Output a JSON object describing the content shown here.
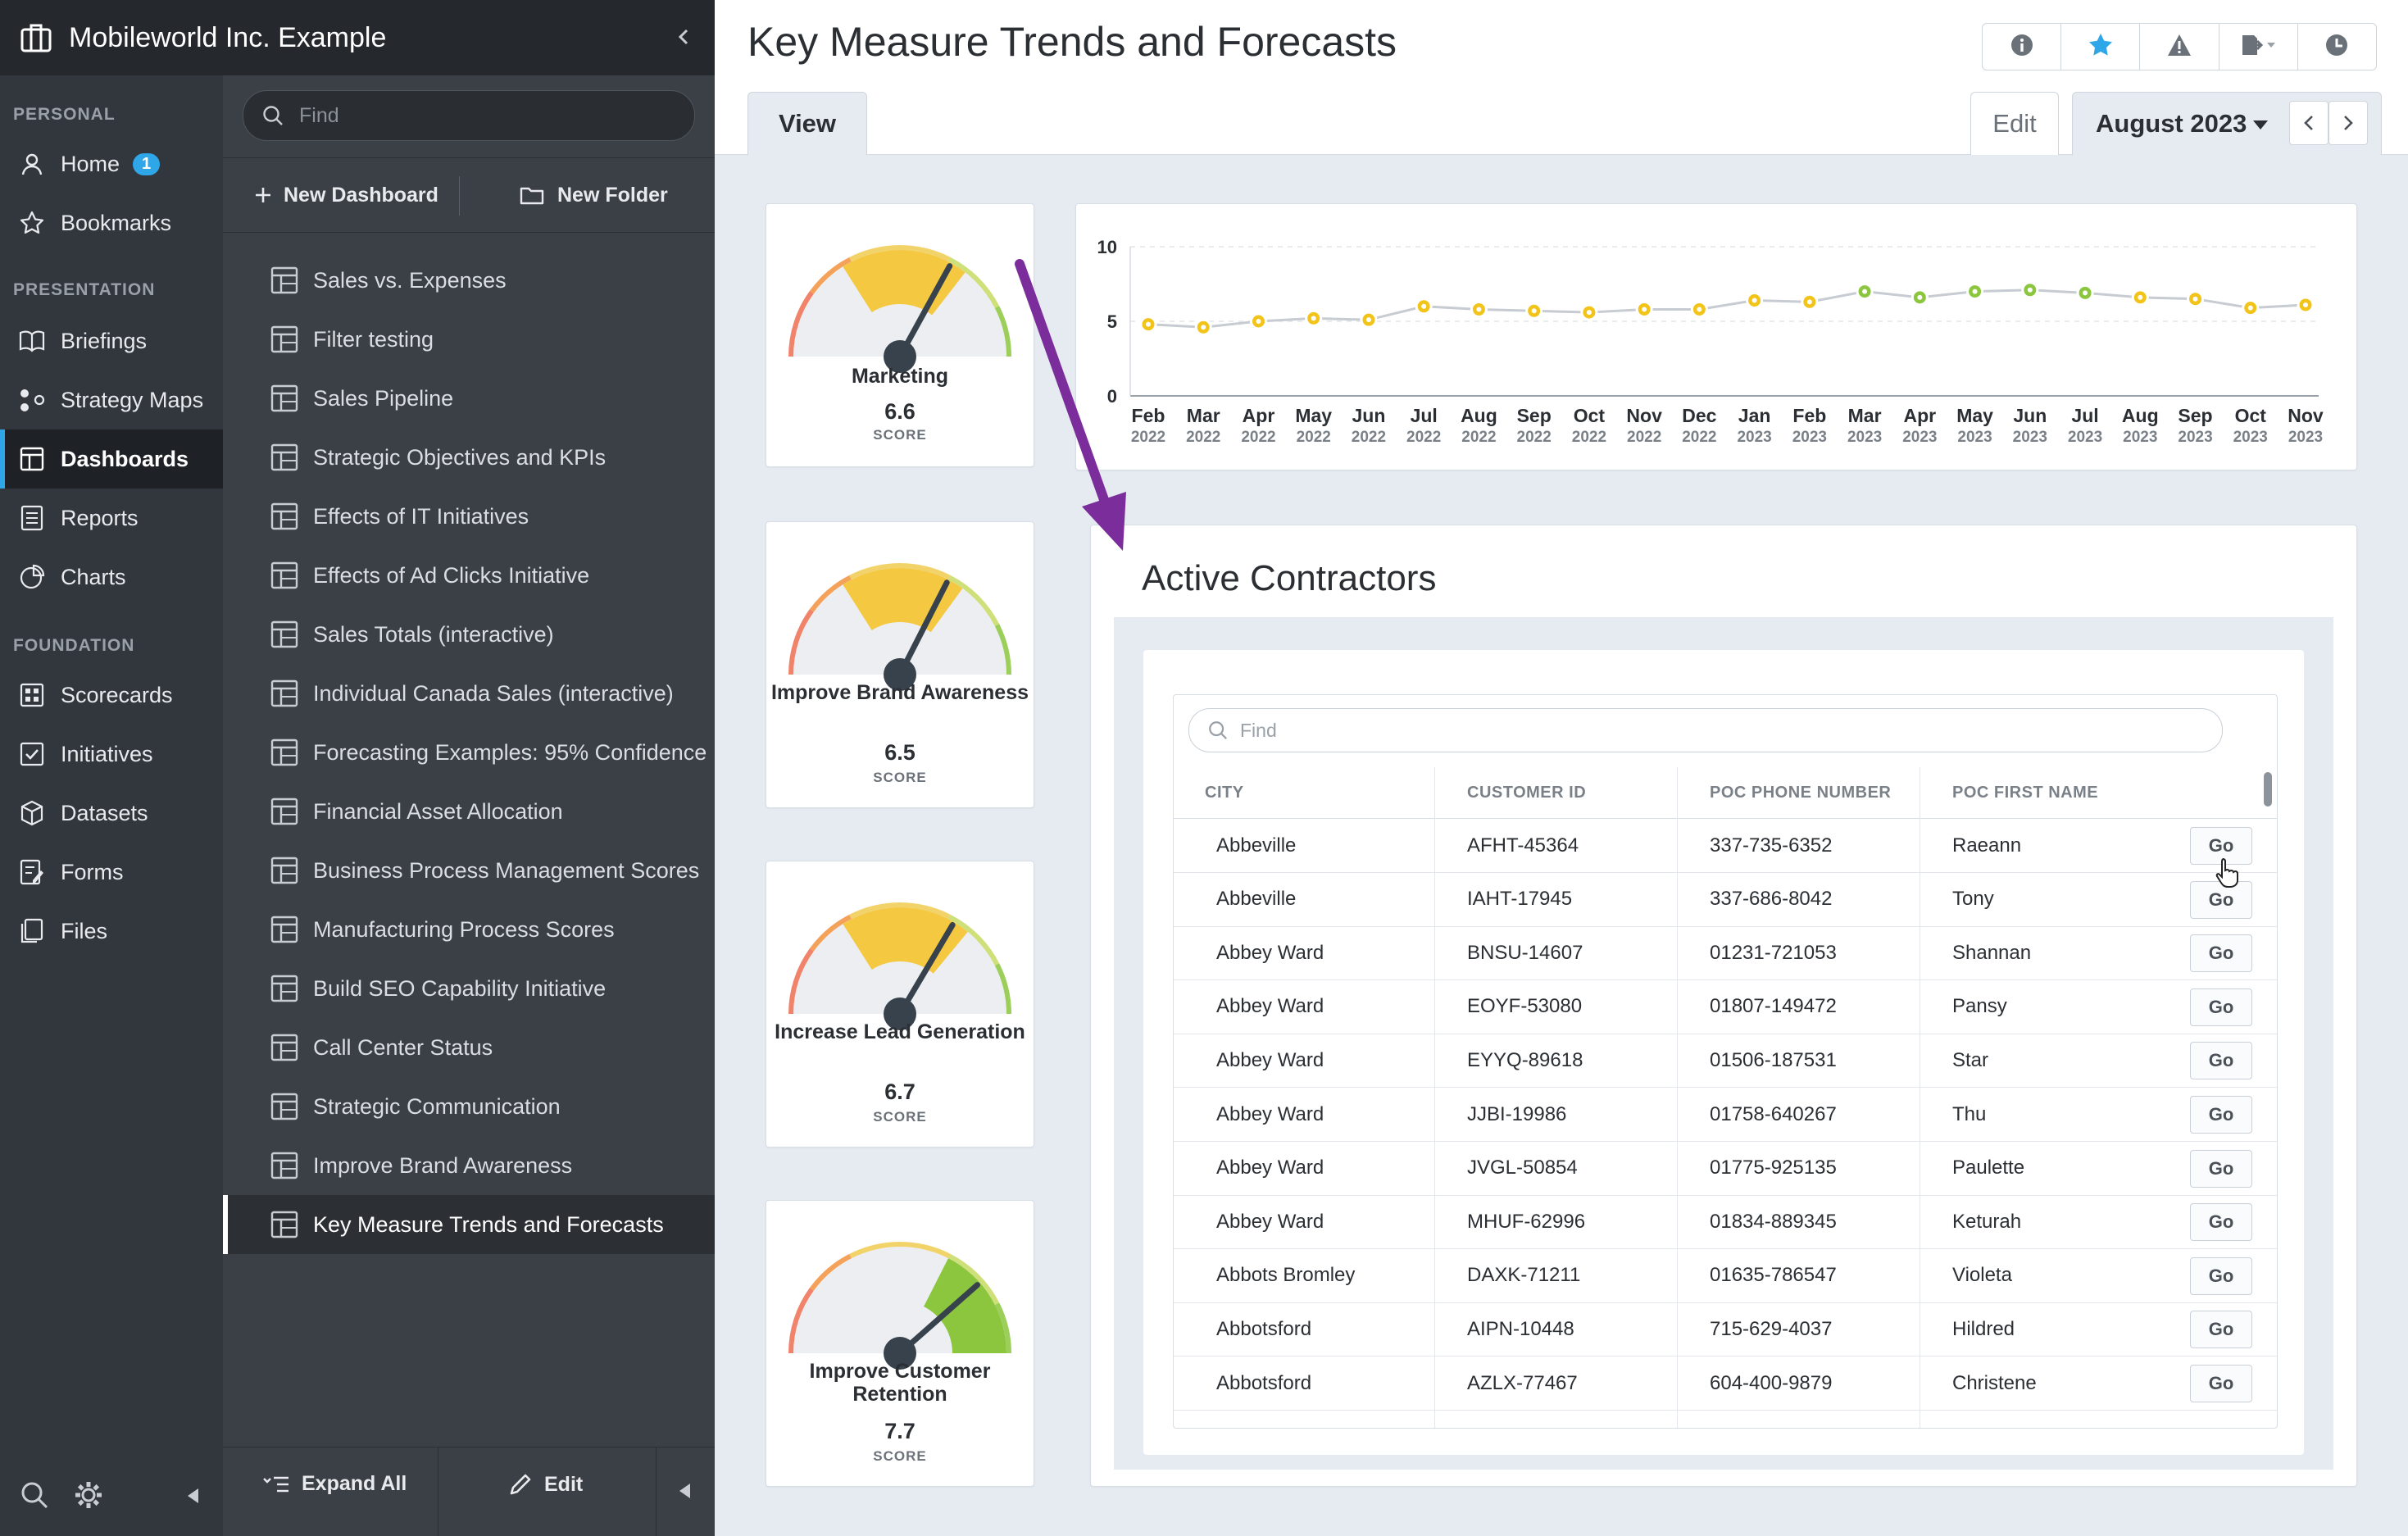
{
  "app": {
    "title": "Mobileworld Inc. Example"
  },
  "nav": {
    "sections": {
      "personal": "PERSONAL",
      "presentation": "PRESENTATION",
      "foundation": "FOUNDATION"
    },
    "items": [
      {
        "label": "Home",
        "icon": "user-icon",
        "badge": "1"
      },
      {
        "label": "Bookmarks",
        "icon": "star-icon"
      },
      {
        "label": "Briefings",
        "icon": "book-icon"
      },
      {
        "label": "Strategy Maps",
        "icon": "strategy-map-icon"
      },
      {
        "label": "Dashboards",
        "icon": "dashboard-icon",
        "active": true
      },
      {
        "label": "Reports",
        "icon": "report-icon"
      },
      {
        "label": "Charts",
        "icon": "pie-chart-icon"
      },
      {
        "label": "Scorecards",
        "icon": "scorecard-icon"
      },
      {
        "label": "Initiatives",
        "icon": "checkbox-icon"
      },
      {
        "label": "Datasets",
        "icon": "cube-icon"
      },
      {
        "label": "Forms",
        "icon": "form-icon"
      },
      {
        "label": "Files",
        "icon": "files-icon"
      }
    ]
  },
  "panel": {
    "search_placeholder": "Find",
    "new_dashboard": "New Dashboard",
    "new_folder": "New Folder",
    "items": [
      "Sales vs. Expenses",
      "Filter testing",
      "Sales Pipeline",
      "Strategic Objectives and KPIs",
      "Effects of IT Initiatives",
      "Effects of Ad Clicks Initiative",
      "Sales Totals (interactive)",
      "Individual Canada Sales (interactive)",
      "Forecasting Examples: 95% Confidence",
      "Financial Asset Allocation",
      "Business Process Management Scores",
      "Manufacturing Process Scores",
      "Build SEO Capability Initiative",
      "Call Center Status",
      "Strategic Communication",
      "Improve Brand Awareness",
      "Key Measure Trends and Forecasts"
    ],
    "active_index": 16,
    "expand_all": "Expand All",
    "edit": "Edit"
  },
  "header": {
    "title": "Key Measure Trends and Forecasts",
    "tab_view": "View",
    "tab_edit": "Edit",
    "period": "August 2023",
    "tools": [
      "info-icon",
      "bookmark-star-icon",
      "alert-icon",
      "export-icon",
      "history-icon"
    ]
  },
  "gauges": [
    {
      "title": "Marketing",
      "score": "6.6",
      "label": "SCORE"
    },
    {
      "title": "Improve Brand Awareness",
      "score": "6.5",
      "label": "SCORE"
    },
    {
      "title": "Increase Lead Generation",
      "score": "6.7",
      "label": "SCORE"
    },
    {
      "title": "Improve Customer Retention",
      "score": "7.7",
      "label": "SCORE"
    }
  ],
  "colors": {
    "accent": "#2fa6e8",
    "point_yellow": "#f2c318",
    "point_green": "#8cc63f",
    "arrow": "#7b2d9b",
    "gauge_fill_yellow": "#f5c842",
    "gauge_fill_green": "#8cc63f"
  },
  "chart_data": {
    "type": "line",
    "ylim": [
      0,
      10
    ],
    "yticks": [
      "0",
      "5",
      "10"
    ],
    "categories": [
      [
        "Feb",
        "2022"
      ],
      [
        "Mar",
        "2022"
      ],
      [
        "Apr",
        "2022"
      ],
      [
        "May",
        "2022"
      ],
      [
        "Jun",
        "2022"
      ],
      [
        "Jul",
        "2022"
      ],
      [
        "Aug",
        "2022"
      ],
      [
        "Sep",
        "2022"
      ],
      [
        "Oct",
        "2022"
      ],
      [
        "Nov",
        "2022"
      ],
      [
        "Dec",
        "2022"
      ],
      [
        "Jan",
        "2023"
      ],
      [
        "Feb",
        "2023"
      ],
      [
        "Mar",
        "2023"
      ],
      [
        "Apr",
        "2023"
      ],
      [
        "May",
        "2023"
      ],
      [
        "Jun",
        "2023"
      ],
      [
        "Jul",
        "2023"
      ],
      [
        "Aug",
        "2023"
      ],
      [
        "Sep",
        "2023"
      ],
      [
        "Oct",
        "2023"
      ],
      [
        "Nov",
        "2023"
      ]
    ],
    "values": [
      4.8,
      4.6,
      5.0,
      5.2,
      5.1,
      6.0,
      5.8,
      5.7,
      5.6,
      5.8,
      5.8,
      6.4,
      6.3,
      7.0,
      6.6,
      7.0,
      7.1,
      6.9,
      6.6,
      6.5,
      5.9,
      6.1
    ],
    "point_status": [
      "y",
      "y",
      "y",
      "y",
      "y",
      "y",
      "y",
      "y",
      "y",
      "y",
      "y",
      "y",
      "y",
      "g",
      "g",
      "g",
      "g",
      "g",
      "y",
      "y",
      "y",
      "y"
    ],
    "grid": true
  },
  "contractors": {
    "title": "Active Contractors",
    "search_placeholder": "Find",
    "columns": [
      "CITY",
      "CUSTOMER ID",
      "POC PHONE NUMBER",
      "POC FIRST NAME"
    ],
    "go_label": "Go",
    "rows": [
      [
        "Abbeville",
        "AFHT-45364",
        "337-735-6352",
        "Raeann"
      ],
      [
        "Abbeville",
        "IAHT-17945",
        "337-686-8042",
        "Tony"
      ],
      [
        "Abbey Ward",
        "BNSU-14607",
        "01231-721053",
        "Shannan"
      ],
      [
        "Abbey Ward",
        "EOYF-53080",
        "01807-149472",
        "Pansy"
      ],
      [
        "Abbey Ward",
        "EYYQ-89618",
        "01506-187531",
        "Star"
      ],
      [
        "Abbey Ward",
        "JJBI-19986",
        "01758-640267",
        "Thu"
      ],
      [
        "Abbey Ward",
        "JVGL-50854",
        "01775-925135",
        "Paulette"
      ],
      [
        "Abbey Ward",
        "MHUF-62996",
        "01834-889345",
        "Keturah"
      ],
      [
        "Abbots Bromley",
        "DAXK-71211",
        "01635-786547",
        "Violeta"
      ],
      [
        "Abbotsford",
        "AIPN-10448",
        "715-629-4037",
        "Hildred"
      ],
      [
        "Abbotsford",
        "AZLX-77467",
        "604-400-9879",
        "Christene"
      ]
    ]
  }
}
